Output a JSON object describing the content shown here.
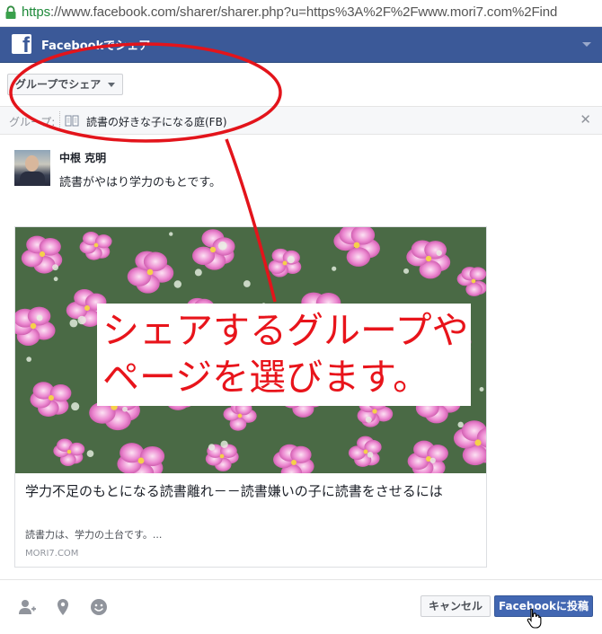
{
  "browser": {
    "url_scheme": "https",
    "url_rest": "://www.facebook.com/sharer/sharer.php?u=https%3A%2F%2Fwww.mori7.com%2Find"
  },
  "header": {
    "title": "Facebookでシェア",
    "brand_color": "#3b5998"
  },
  "share_target": {
    "dropdown_label": "グループでシェア"
  },
  "group": {
    "label": "グループ:",
    "name": "読書の好きな子になる庭(FB)"
  },
  "composer": {
    "user_name": "中根 克明",
    "message": "読書がやはり学力のもとです。"
  },
  "preview": {
    "title": "学力不足のもとになる読書離れ－－読書嫌いの子に読書をさせるには",
    "description": "読書力は、学力の土台です。...",
    "domain": "MORI7.COM"
  },
  "annotation": {
    "line1": "シェアするグループや",
    "line2": "ページを選びます。",
    "color": "#e8141b"
  },
  "footer": {
    "icons": [
      "tag-friends-icon",
      "location-pin-icon",
      "feeling-smiley-icon"
    ],
    "cancel_label": "キャンセル",
    "post_label": "Facebookに投稿",
    "post_color": "#4267b2"
  }
}
